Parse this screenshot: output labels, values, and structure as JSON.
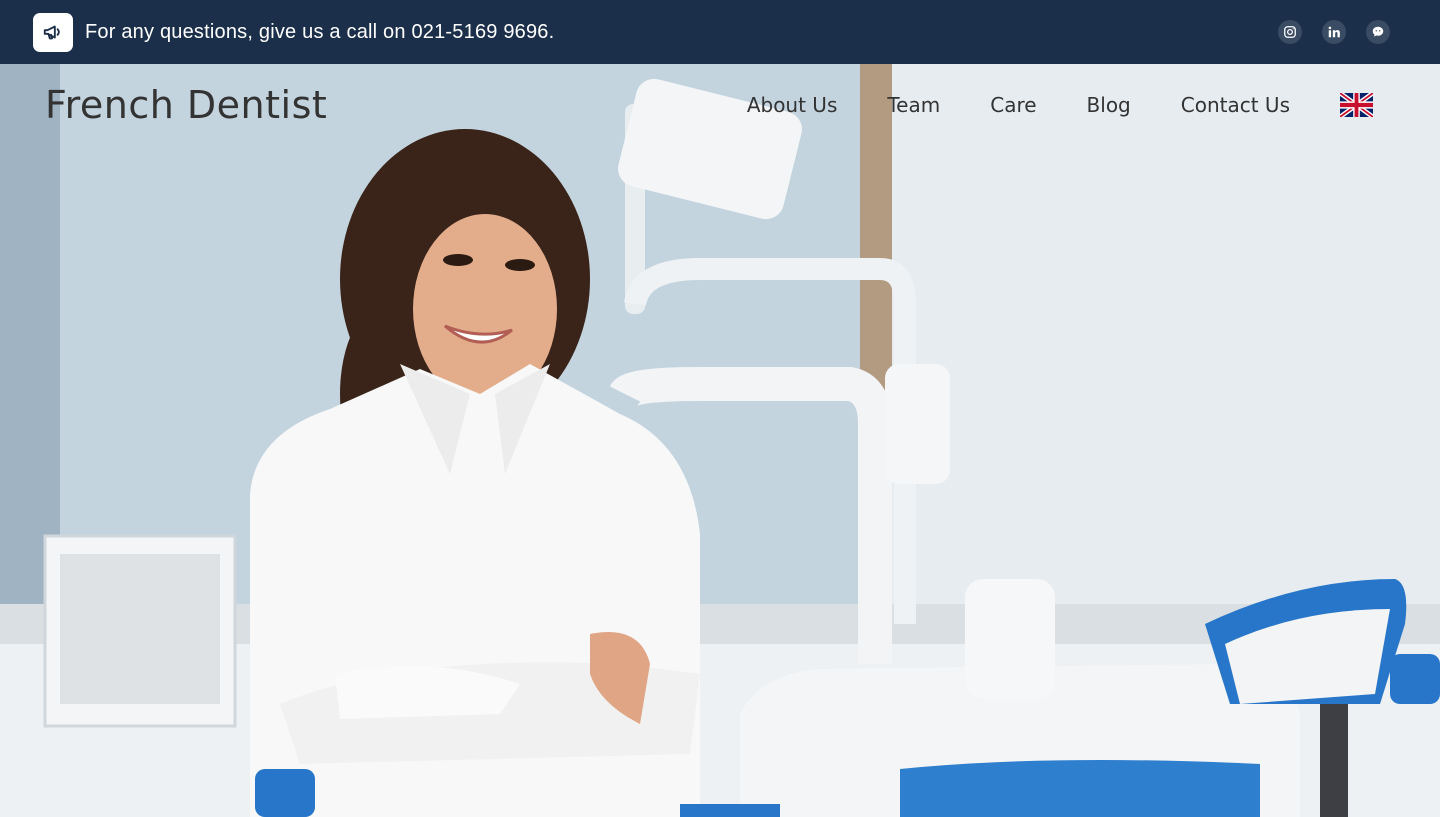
{
  "topbar": {
    "announcement": "For any questions, give us a call on 021-5169 9696.",
    "icon": "megaphone-icon",
    "background": "#1b2f4a",
    "socials": [
      {
        "name": "instagram-icon"
      },
      {
        "name": "linkedin-icon"
      },
      {
        "name": "wechat-icon"
      }
    ]
  },
  "navbar": {
    "brand": "French Dentist",
    "links": [
      "About Us",
      "Team",
      "Care",
      "Blog",
      "Contact Us"
    ],
    "language_icon": "uk-flag-icon"
  },
  "hero": {
    "image": "smiling dentist in white coat standing with arms crossed in a dental clinic"
  }
}
